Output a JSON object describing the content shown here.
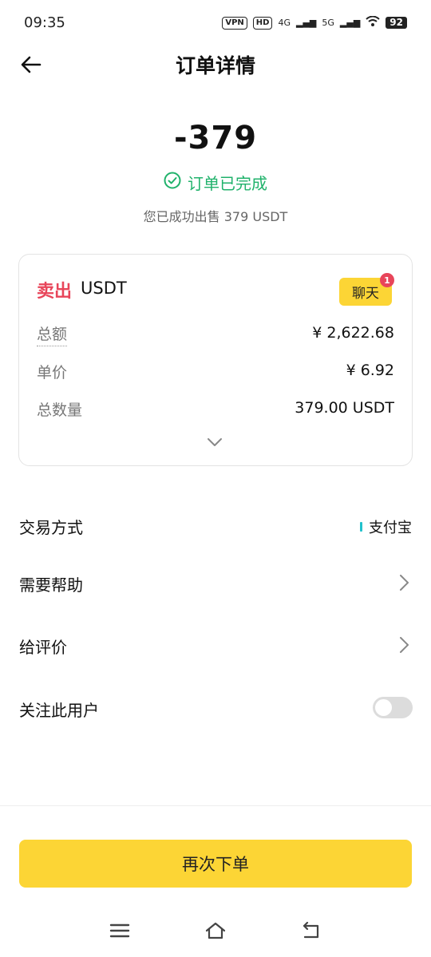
{
  "status_bar": {
    "time": "09:35",
    "vpn": "VPN",
    "hd": "HD",
    "net1": "4G",
    "net2": "5G",
    "battery": "92"
  },
  "header": {
    "title": "订单详情"
  },
  "summary": {
    "amount": "-379",
    "status": "订单已完成",
    "status_color": "#20b26b",
    "description": "您已成功出售 379 USDT"
  },
  "order_card": {
    "side": "卖出",
    "asset": "USDT",
    "chat_label": "聊天",
    "chat_unread": "1",
    "rows": [
      {
        "label": "总额",
        "value": "¥ 2,622.68"
      },
      {
        "label": "单价",
        "value": "¥ 6.92"
      },
      {
        "label": "总数量",
        "value": "379.00 USDT"
      }
    ]
  },
  "details": {
    "payment_label": "交易方式",
    "payment_value": "支付宝",
    "help_label": "需要帮助",
    "review_label": "给评价",
    "follow_label": "关注此用户",
    "follow_enabled": false
  },
  "action": {
    "reorder_label": "再次下单",
    "accent": "#fcd535"
  },
  "icons": [
    "back-arrow-icon",
    "check-circle-icon",
    "chevron-down-icon",
    "chevron-right-icon",
    "menu-icon",
    "home-icon",
    "return-icon"
  ]
}
